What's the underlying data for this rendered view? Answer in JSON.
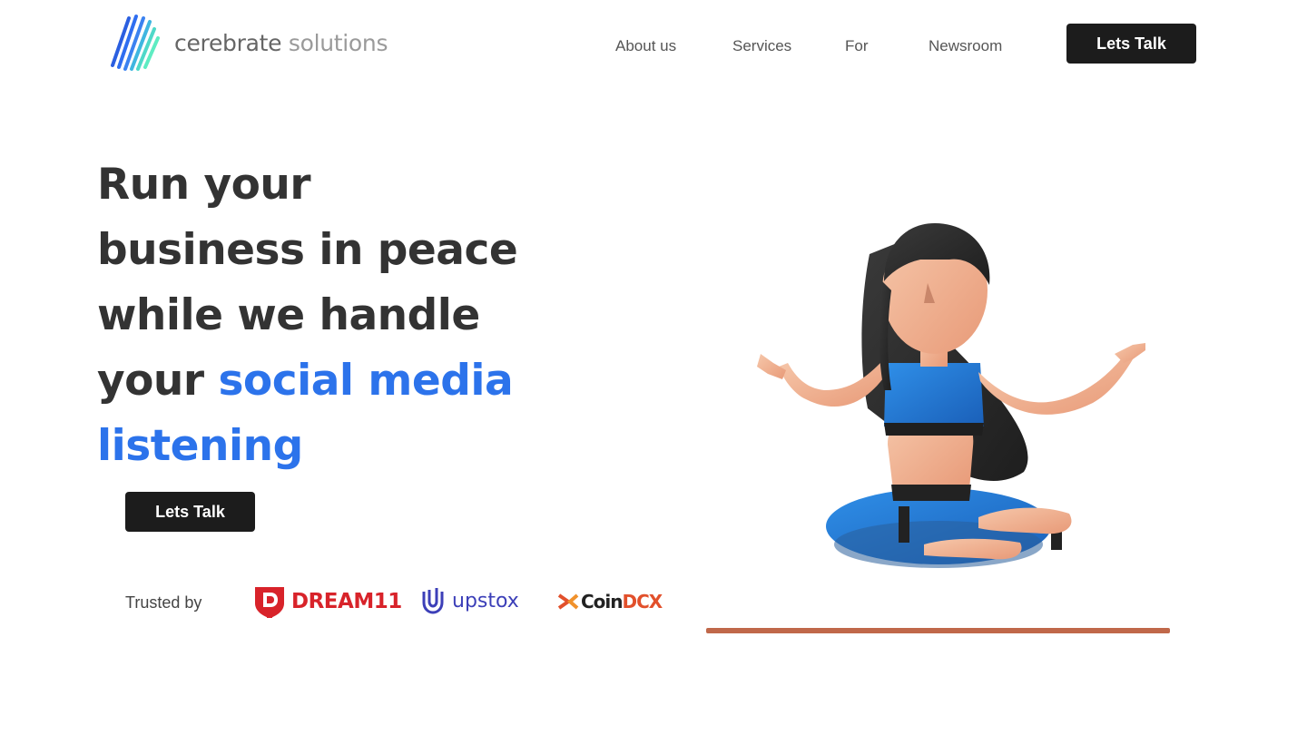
{
  "brand": {
    "name_part1": "cerebrate",
    "name_part2": "solutions",
    "logo_icon": "diagonal-stripes-logo"
  },
  "nav": {
    "items": [
      {
        "label": "About us"
      },
      {
        "label": "Services"
      },
      {
        "label": "For"
      },
      {
        "label": "Newsroom"
      }
    ],
    "cta_label": "Lets Talk"
  },
  "hero": {
    "line1": "Run your",
    "line2": "business in peace",
    "line3": "while we handle",
    "line4_plain": "your",
    "line4_accent": "social media",
    "line5_accent": "listening",
    "cta_label": "Lets Talk",
    "illustration": "meditating-woman-3d-illustration"
  },
  "trusted": {
    "label": "Trusted by",
    "logos": [
      {
        "name": "DREAM11",
        "icon": "dream11-shield-icon"
      },
      {
        "name": "upstox",
        "icon": "upstox-u-icon"
      },
      {
        "name_part1": "Coin",
        "name_part2": "DCX",
        "icon": "coindcx-x-icon"
      }
    ]
  },
  "colors": {
    "accent": "#2c73eb",
    "text": "#333333",
    "button": "#1c1c1c",
    "dream11": "#d8232a",
    "upstox": "#3c3fb8",
    "coindcx": "#e2502b"
  }
}
